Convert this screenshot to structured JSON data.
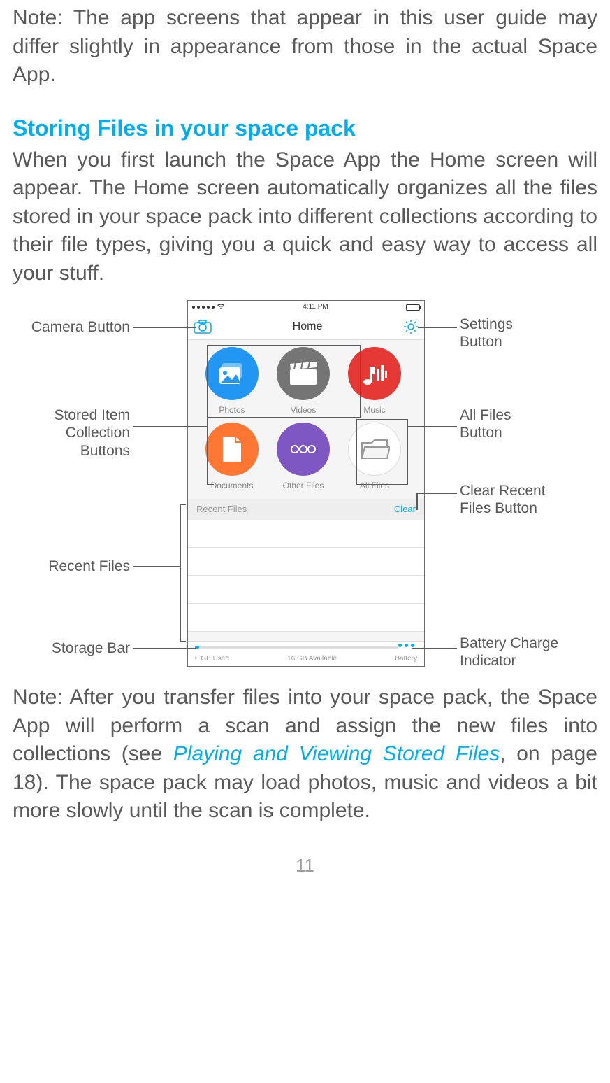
{
  "note1": "Note: The app screens that appear in this user guide may differ slightly in appearance from those in the actual Space App.",
  "heading": "Storing Files in your space pack",
  "para1": "When you first launch the Space App the Home screen will appear. The Home screen automatically organizes all the files stored in your space pack into different collections according to their file types, giving you a quick and easy way to access all your stuff.",
  "phone": {
    "time": "4:11 PM",
    "title": "Home",
    "tiles": {
      "photos": "Photos",
      "videos": "Videos",
      "music": "Music",
      "documents": "Documents",
      "other": "Other Files",
      "all": "All Files"
    },
    "recent_label": "Recent Files",
    "clear_label": "Clear",
    "used": "0 GB Used",
    "available": "16 GB Available",
    "battery": "Battery"
  },
  "callouts": {
    "camera": "Camera Button",
    "stored1": "Stored Item",
    "stored2": "Collection",
    "stored3": "Buttons",
    "recent": "Recent Files",
    "storage": "Storage Bar",
    "settings1": "Settings",
    "settings2": "Button",
    "allfiles1": "All Files",
    "allfiles2": "Button",
    "clearrec1": "Clear Recent",
    "clearrec2": "Files Button",
    "battchg1": "Battery Charge",
    "battchg2": "Indicator"
  },
  "note2a": "Note: After you transfer files into your space pack, the Space App will perform a scan and assign the new files into collections (see ",
  "note2link": "Playing and Viewing Stored Files",
  "note2b": ", on page 18). The space pack may load photos, music and videos a bit more slowly until the scan is complete.",
  "pagenum": "11"
}
